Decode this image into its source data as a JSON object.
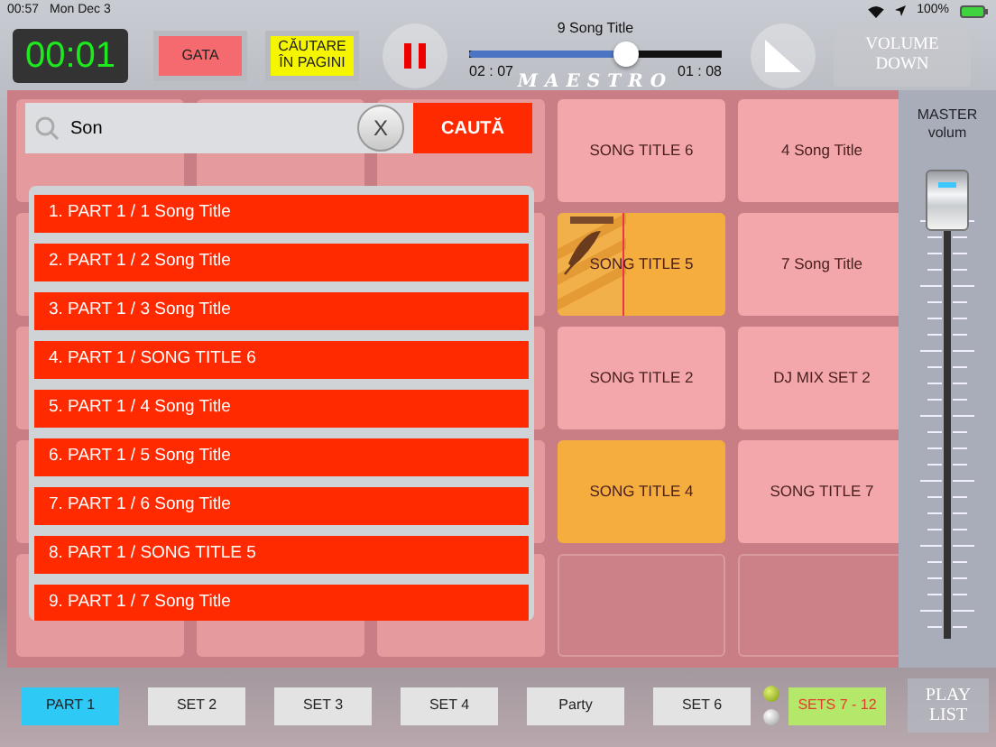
{
  "status_bar": {
    "time": "00:57",
    "date": "Mon Dec 3",
    "battery": "100%"
  },
  "header": {
    "timer": "00:01",
    "buttons": [
      {
        "label": "GATA",
        "color": "#f46a6e"
      },
      {
        "label": "CĂUTARE ÎN PAGINI",
        "color": "#f5f500"
      }
    ],
    "now_playing": {
      "title": "9 Song Title",
      "level": 0.62,
      "elapsed": "02 : 07",
      "remaining": "01 : 08"
    },
    "logo": "MAESTRO",
    "volume_button": "VOLUME DOWN"
  },
  "search": {
    "value": "Son",
    "clear": "X",
    "button": "CAUTĂ"
  },
  "results": [
    "1. PART 1 / 1 Song Title",
    "2. PART 1 / 2 Song Title",
    "3. PART 1 / 3 Song Title",
    "4. PART 1 / SONG TITLE 6",
    "5. PART 1 / 4 Song Title",
    "6. PART 1 / 5 Song Title",
    "7. PART 1 / 6 Song Title",
    "8. PART 1 / SONG TITLE 5",
    "9. PART 1 / 7 Song Title"
  ],
  "pads": [
    {
      "kind": "song",
      "label": "SONG TITLE 6",
      "color": "#f4a7aa"
    },
    {
      "kind": "song",
      "label": "4 Song Title",
      "color": "#f4a7aa"
    },
    {
      "kind": "artwork",
      "label": "SONG TITLE 5",
      "color": "#f5ad3d"
    },
    {
      "kind": "song",
      "label": "7 Song Title",
      "color": "#f4a7aa"
    },
    {
      "kind": "song",
      "label": "SONG TITLE 2",
      "color": "#f4a7aa"
    },
    {
      "kind": "song",
      "label": "DJ MIX SET 2",
      "color": "#f4a7aa"
    },
    {
      "kind": "song",
      "label": "SONG TITLE 4",
      "color": "#f5ad3d"
    },
    {
      "kind": "song",
      "label": "SONG TITLE 7",
      "color": "#f4a7aa"
    },
    {
      "kind": "empty"
    },
    {
      "kind": "empty"
    }
  ],
  "master": {
    "title": "MASTER",
    "subtitle": "volum"
  },
  "sets": [
    {
      "label": "PART 1",
      "selected": true
    },
    {
      "label": "SET 2",
      "selected": false
    },
    {
      "label": "SET 3",
      "selected": false
    },
    {
      "label": "SET 4",
      "selected": false
    },
    {
      "label": "Party",
      "selected": false
    },
    {
      "label": "SET 6",
      "selected": false
    }
  ],
  "set_indicators": [
    {
      "on": true
    },
    {
      "on": false
    }
  ],
  "sets_more": "SETS 7 - 12",
  "play_list": "PLAY LIST"
}
